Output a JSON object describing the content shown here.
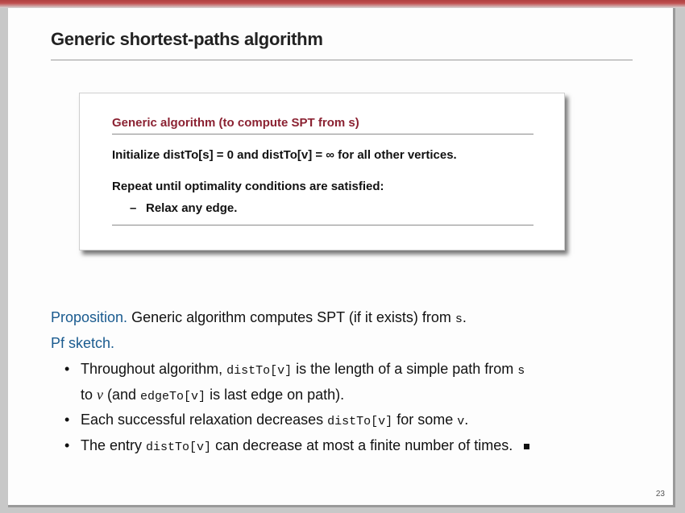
{
  "slide": {
    "title": "Generic shortest-paths algorithm",
    "box": {
      "heading": "Generic algorithm (to compute SPT from s)",
      "line1": "Initialize distTo[s] = 0 and distTo[v] = ∞ for all other vertices.",
      "line2": "Repeat until optimality conditions are satisfied:",
      "sub_dash": "–",
      "sub_item": "Relax any edge."
    },
    "proposition": {
      "label": "Proposition.",
      "text_a": " Generic algorithm computes SPT (if it exists) from ",
      "s": "s",
      "text_b": "."
    },
    "pf_label": "Pf sketch.",
    "bullets": {
      "b1_a": "Throughout algorithm, ",
      "b1_code": "distTo[v]",
      "b1_b": " is the length of a simple path from ",
      "b1_s": "s",
      "b1_cont_a": "to ",
      "b1_v": "v",
      "b1_cont_b": " (and ",
      "b1_code2": "edgeTo[v]",
      "b1_cont_c": " is last edge on path).",
      "b2_a": "Each successful relaxation decreases ",
      "b2_code": "distTo[v]",
      "b2_b": " for some ",
      "b2_v": "v",
      "b2_c": ".",
      "b3_a": "The entry ",
      "b3_code": "distTo[v]",
      "b3_b": " can decrease at most a finite number of times."
    },
    "bullet_char": "•",
    "page_number": "23"
  }
}
